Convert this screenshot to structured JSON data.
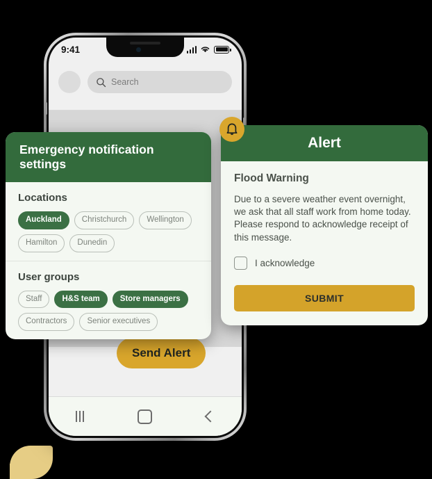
{
  "phone": {
    "status_bar": {
      "time": "9:41",
      "signal_icon": "cellular-signal-icon",
      "wifi_icon": "wifi-icon",
      "battery_icon": "battery-icon"
    },
    "search": {
      "placeholder": "Search",
      "icon": "search-icon",
      "avatar": "avatar"
    },
    "send_alert_label": "Send Alert",
    "nav_bar": {
      "recents_icon": "recents-icon",
      "home_icon": "home-icon",
      "back_icon": "back-icon"
    }
  },
  "bell_badge": {
    "icon": "bell-icon"
  },
  "settings_card": {
    "title": "Emergency notification settings",
    "sections": [
      {
        "title": "Locations",
        "chips": [
          {
            "label": "Auckland",
            "selected": true
          },
          {
            "label": "Christchurch",
            "selected": false
          },
          {
            "label": "Wellington",
            "selected": false
          },
          {
            "label": "Hamilton",
            "selected": false
          },
          {
            "label": "Dunedin",
            "selected": false
          }
        ]
      },
      {
        "title": "User groups",
        "chips": [
          {
            "label": "Staff",
            "selected": false
          },
          {
            "label": "H&S team",
            "selected": true
          },
          {
            "label": "Store managers",
            "selected": true
          },
          {
            "label": "Contractors",
            "selected": false
          },
          {
            "label": "Senior executives",
            "selected": false
          }
        ]
      }
    ]
  },
  "alert_card": {
    "header": "Alert",
    "title": "Flood Warning",
    "body": "Due to a severe weather event overnight, we ask that all staff work from home today. Please respond to acknowledge receipt of this message.",
    "acknowledge_label": "I acknowledge",
    "acknowledge_checked": false,
    "submit_label": "SUBMIT"
  },
  "colors": {
    "brand_green": "#336b3c",
    "chip_green": "#3b7044",
    "gold": "#d9a62c",
    "submit_gold": "#d4a32a",
    "card_bg": "#f4f8f2",
    "deco_gold": "#e6cd85",
    "page_bg": "#000000"
  }
}
